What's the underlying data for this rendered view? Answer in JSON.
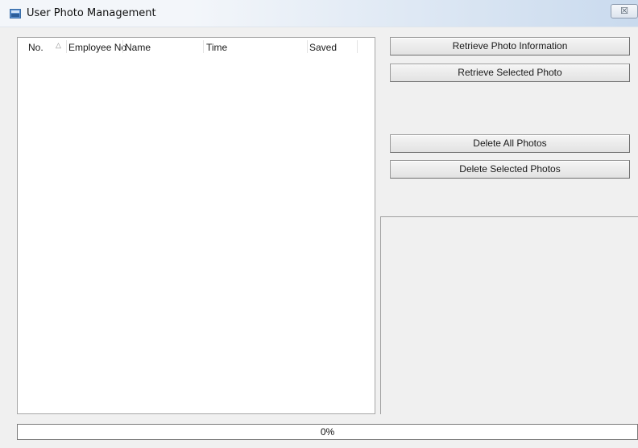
{
  "window": {
    "title": "User Photo Management",
    "close_glyph": "☒"
  },
  "photo_list": {
    "columns": [
      "No.",
      "Employee No",
      "Name",
      "Time",
      "Saved"
    ],
    "sort_indicator": "△",
    "rows": []
  },
  "actions": {
    "retrieve_info": "Retrieve Photo Information",
    "retrieve_selected": "Retrieve Selected Photo",
    "delete_all": "Delete All Photos",
    "delete_selected": "Delete Selected Photos"
  },
  "progress": {
    "value": 0,
    "label": "0%"
  },
  "colors": {
    "progress_fill": "#3c9a3c"
  }
}
